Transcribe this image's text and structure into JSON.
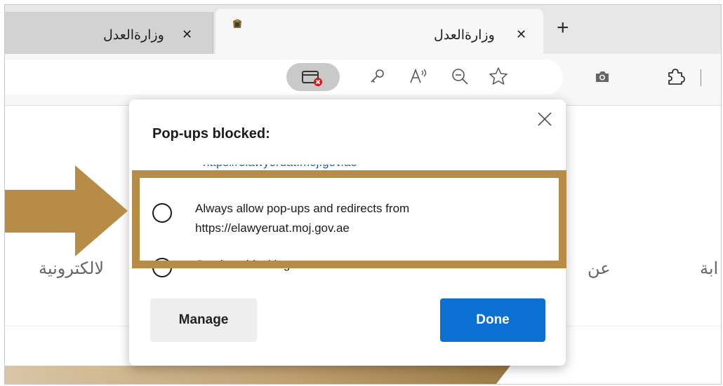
{
  "colors": {
    "accent": "#0c70d2",
    "annotation": "#b68c46",
    "link": "#0a5bb5"
  },
  "tabs": [
    {
      "title": "وزارةالعدل",
      "close_icon": "close-icon",
      "state": "inactive"
    },
    {
      "title": "وزارةالعدل",
      "close_icon": "close-icon",
      "state": "active"
    }
  ],
  "new_tab_icon": "plus-icon",
  "toolbar": {
    "icons": [
      "popup-blocked-icon",
      "key-icon",
      "read-aloud-icon",
      "zoom-out-icon",
      "favorite-star-icon",
      "camera-icon",
      "extensions-icon"
    ]
  },
  "page": {
    "nav_items": [
      "لالكترونية",
      "عن",
      "ابة"
    ]
  },
  "popup": {
    "title": "Pop-ups blocked:",
    "options": [
      {
        "line1": "Always allow pop-ups and redirects from",
        "line2": "https://elawyeruat.moj.gov.ae",
        "selected": false
      },
      {
        "label": "Continue blocking",
        "selected": false
      }
    ],
    "manage_label": "Manage",
    "done_label": "Done"
  }
}
